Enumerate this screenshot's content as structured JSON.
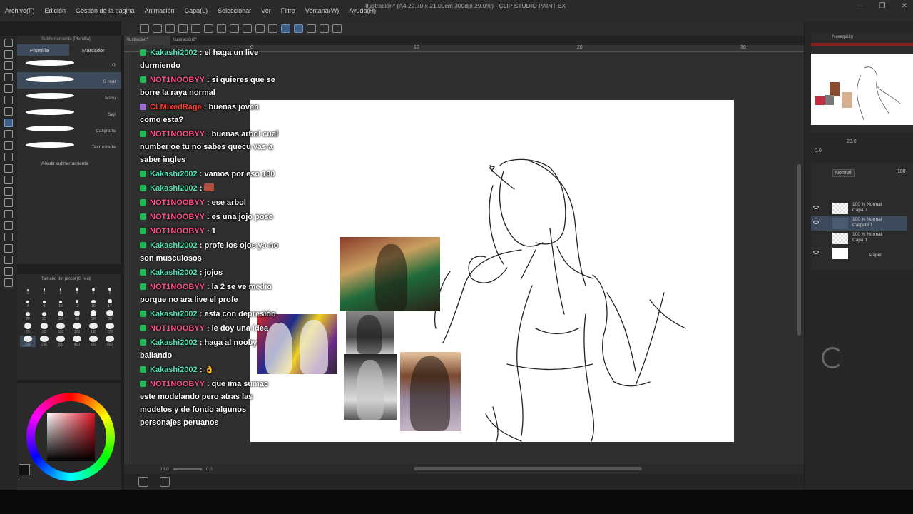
{
  "window": {
    "title": "Ilustración* (A4 29.70 x 21.00cm 300dpi 29.0%) - CLIP STUDIO PAINT EX",
    "controls": [
      "—",
      "❐",
      "✕"
    ]
  },
  "menu": [
    "Archivo(F)",
    "Edición",
    "Gestión de la página",
    "Animación",
    "Capa(L)",
    "Seleccionar",
    "Ver",
    "Filtro",
    "Ventana(W)",
    "Ayuda(H)"
  ],
  "subtool": {
    "header": "Subherramienta [Plumilla]",
    "tabs": [
      "Plumilla",
      "Marcador"
    ],
    "brushes": [
      "G",
      "G real",
      "Maru",
      "Saji",
      "Caligrafía",
      "Texturizada"
    ],
    "selected_brush": "G real",
    "add_label": "Añadir subherramienta"
  },
  "brush_size": {
    "title": "Tamaño del pincel [G real]",
    "sizes": [
      "1",
      "2",
      "3",
      "4",
      "5",
      "6",
      "7",
      "8",
      "10",
      "12",
      "15",
      "17",
      "20",
      "25",
      "30",
      "40",
      "50",
      "60",
      "70",
      "80",
      "100",
      "120",
      "150",
      "170",
      "200",
      "250",
      "300",
      "400",
      "500",
      "600"
    ],
    "selected": "200"
  },
  "doc_tabs": [
    "Ilustración*",
    "Ilustración2*"
  ],
  "ruler": [
    "0",
    "10",
    "20",
    "30"
  ],
  "chat": [
    {
      "badge": "green",
      "user": "Kakashi2002",
      "text": "el haga un live durmiendo",
      "color": "cyan"
    },
    {
      "badge": "green",
      "user": "NOT1NOOBYY",
      "text": "si quieres que se borre la raya normal",
      "color": "pink"
    },
    {
      "badge": "purple",
      "user": "CLMixedRage",
      "text": "buenas joven como esta?",
      "color": "red"
    },
    {
      "badge": "green",
      "user": "NOT1NOOBYY",
      "text": "buenas arbol cual number oe tu no sabes quecu vas a saber ingles",
      "color": "pink"
    },
    {
      "badge": "green",
      "user": "Kakashi2002",
      "text": "vamos por eso 100",
      "color": "cyan"
    },
    {
      "badge": "green",
      "user": "Kakashi2002",
      "text": "",
      "color": "cyan",
      "emote": true
    },
    {
      "badge": "green",
      "user": "NOT1NOOBYY",
      "text": "ese arbol",
      "color": "pink"
    },
    {
      "badge": "green",
      "user": "NOT1NOOBYY",
      "text": "es una jojo pose",
      "color": "pink"
    },
    {
      "badge": "green",
      "user": "NOT1NOOBYY",
      "text": "1",
      "color": "pink"
    },
    {
      "badge": "green",
      "user": "Kakashi2002",
      "text": "profe los ojos ya no son musculosos",
      "color": "cyan"
    },
    {
      "badge": "green",
      "user": "Kakashi2002",
      "text": "jojos",
      "color": "cyan"
    },
    {
      "badge": "green",
      "user": "NOT1NOOBYY",
      "text": "la 2 se ve medio porque no ara live el profe",
      "color": "pink"
    },
    {
      "badge": "green",
      "user": "Kakashi2002",
      "text": "esta con depresión",
      "color": "cyan"
    },
    {
      "badge": "green",
      "user": "NOT1NOOBYY",
      "text": "le doy una idea",
      "color": "pink"
    },
    {
      "badge": "green",
      "user": "Kakashi2002",
      "text": "haga al nooby bailando",
      "color": "cyan"
    },
    {
      "badge": "green",
      "user": "Kakashi2002",
      "text": "👌",
      "color": "cyan"
    },
    {
      "badge": "green",
      "user": "NOT1NOOBYY",
      "text": "que ima sumac este modelando pero atras las modelos y de fondo algunos personajes peruanos",
      "color": "pink"
    }
  ],
  "navigator": {
    "title": "Navegador",
    "zoom": "29.0",
    "angle": "0.0"
  },
  "layers": {
    "blend_mode": "Normal",
    "opacity": "100",
    "items": [
      {
        "mode": "100 % Normal",
        "name": "Capa 7",
        "type": "raster"
      },
      {
        "mode": "100 % Normal",
        "name": "Carpeta 1",
        "type": "folder",
        "selected": true
      },
      {
        "mode": "100 % Normal",
        "name": "Capa 1",
        "type": "raster"
      },
      {
        "mode": "",
        "name": "Papel",
        "type": "paper"
      }
    ]
  },
  "status": {
    "zoom": "29.0",
    "angle": "0.0"
  },
  "colors": {
    "accent": "#3d4a5c",
    "chat_pink": "#ff4f8b",
    "chat_cyan": "#4fe3b8",
    "chat_red": "#ff3a2a"
  }
}
